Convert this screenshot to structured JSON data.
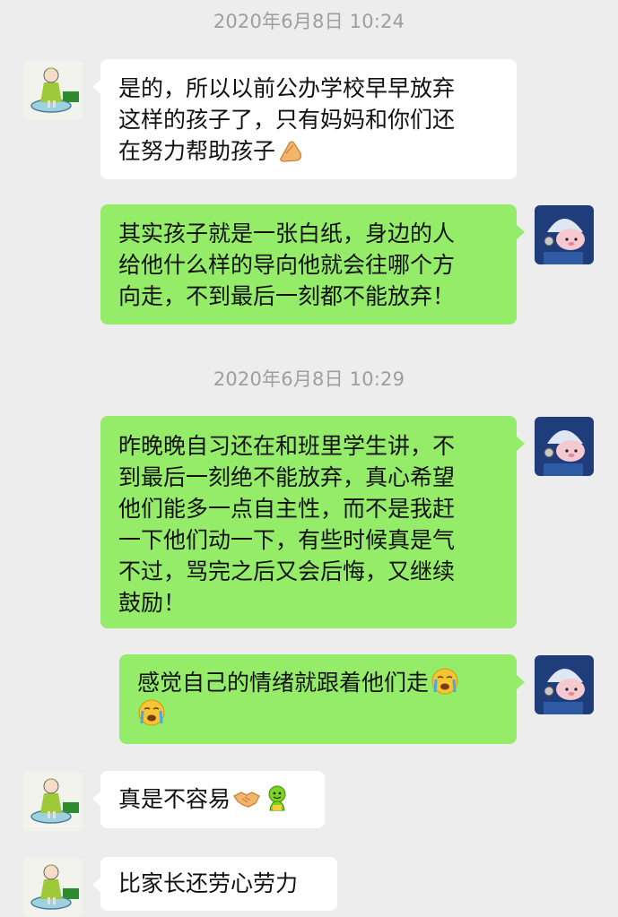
{
  "chat": {
    "timestamps": [
      {
        "text": "2020年6月8日 10:24"
      },
      {
        "text": "2020年6月8日 10:29"
      }
    ],
    "messages": [
      {
        "sender": "other",
        "lines": [
          "是的，所以以前公办学校早早放弃",
          "这样的孩子了，只有妈妈和你们还",
          "在努力帮助孩子"
        ],
        "emoji_after": [
          "clapping-hands-icon"
        ]
      },
      {
        "sender": "self",
        "lines": [
          "其实孩子就是一张白纸，身边的人",
          "给他什么样的导向他就会往哪个方",
          "向走，不到最后一刻都不能放弃！"
        ]
      },
      {
        "sender": "self",
        "lines": [
          "昨晚晚自习还在和班里学生讲，不",
          "到最后一刻绝不能放弃，真心希望",
          "他们能多一点自主性，而不是我赶",
          "一下他们动一下，有些时候真是气",
          "不过，骂完之后又会后悔，又继续",
          "鼓励！"
        ]
      },
      {
        "sender": "self",
        "lines": [
          "感觉自己的情绪就跟着他们走"
        ],
        "emoji_after": [
          "crying-face-icon",
          "crying-face-icon"
        ]
      },
      {
        "sender": "other",
        "lines": [
          "真是不容易"
        ],
        "emoji_after": [
          "handshake-icon",
          "green-smiley-icon"
        ]
      },
      {
        "sender": "other",
        "lines": [
          "比家长还劳心劳力"
        ]
      }
    ]
  },
  "colors": {
    "background": "#ededed",
    "incoming_bubble": "#ffffff",
    "outgoing_bubble": "#95ec69",
    "timestamp_text": "#9e9e9e",
    "message_text": "#111111"
  }
}
